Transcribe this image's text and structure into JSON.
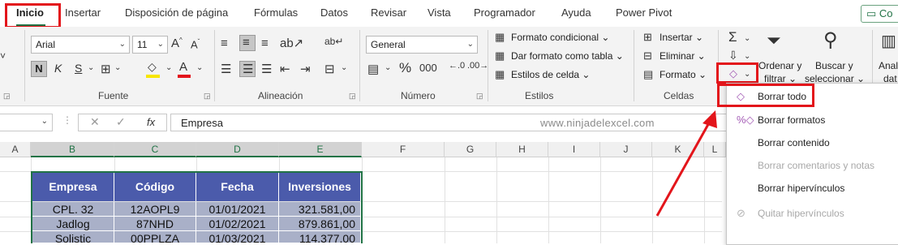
{
  "tabs": [
    "Inicio",
    "Insertar",
    "Disposición de página",
    "Fórmulas",
    "Datos",
    "Revisar",
    "Vista",
    "Programador",
    "Ayuda",
    "Power Pivot"
  ],
  "share_label": "Co",
  "ribbon": {
    "font_name": "Arial",
    "font_size": "11",
    "bold": "N",
    "italic": "K",
    "underline": "S",
    "number_format": "General",
    "percent": "%",
    "thousands": "000",
    "cond_format": "Formato condicional",
    "format_table": "Dar formato como tabla",
    "cell_styles": "Estilos de celda",
    "insert": "Insertar",
    "delete": "Eliminar",
    "format": "Formato",
    "sort_filter_1": "Ordenar y",
    "sort_filter_2": "filtrar",
    "find_1": "Buscar y",
    "find_2": "seleccionar",
    "analyze_1": "Anal",
    "analyze_2": "dat",
    "groups": {
      "fuente": "Fuente",
      "alineacion": "Alineación",
      "numero": "Número",
      "estilos": "Estilos",
      "celdas": "Celdas"
    }
  },
  "formula_bar": {
    "cell_content": "Empresa",
    "fx": "fx",
    "watermark": "www.ninjadelexcel.com"
  },
  "columns": [
    "A",
    "B",
    "C",
    "D",
    "E",
    "F",
    "G",
    "H",
    "I",
    "J",
    "K",
    "L"
  ],
  "table": {
    "headers": [
      "Empresa",
      "Código",
      "Fecha",
      "Inversiones"
    ],
    "rows": [
      [
        "CPL. 32",
        "12AOPL9",
        "01/01/2021",
        "321.581,00"
      ],
      [
        "Jadlog",
        "87NHD",
        "01/02/2021",
        "879.861,00"
      ],
      [
        "Solistic",
        "00PPLZA",
        "01/03/2021",
        "114.377,00"
      ]
    ]
  },
  "menu": {
    "items": [
      {
        "label": "Borrar todo",
        "enabled": true
      },
      {
        "label": "Borrar formatos",
        "enabled": true
      },
      {
        "label": "Borrar contenido",
        "enabled": true
      },
      {
        "label": "Borrar comentarios y notas",
        "enabled": false
      },
      {
        "label": "Borrar hipervínculos",
        "enabled": true
      },
      {
        "label": "Quitar hipervínculos",
        "enabled": false
      }
    ]
  },
  "colors": {
    "accent": "#217346",
    "highlight": "#e3151b",
    "table_header": "#4b5bab",
    "table_row": "#a9b0c8"
  }
}
